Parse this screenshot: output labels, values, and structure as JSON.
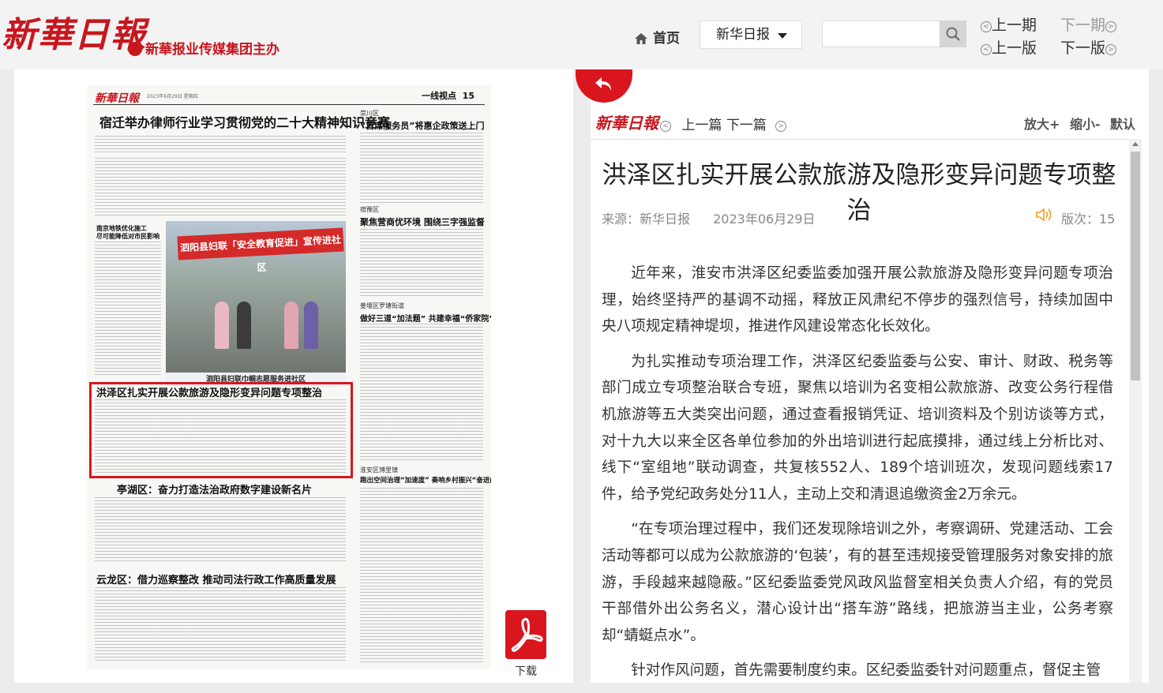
{
  "header": {
    "logo": "新華日報",
    "sponsor": "新華报业传媒集团主办",
    "home_label": "首页",
    "paper_select": "新华日报",
    "search_placeholder": "",
    "prev_issue": "上一期",
    "next_issue": "下一期",
    "prev_page": "上一版",
    "next_page": "下一版"
  },
  "newspaper": {
    "logo": "新華日報",
    "date": "2023年6月29日 星期四",
    "section": "一线视点",
    "page": "15",
    "headlines": {
      "h1": "宿迁举办律师行业学习贯彻党的二十大精神知识竞赛",
      "h2": "南京地铁优化施工",
      "h2b": "尽可能降低对市民影响",
      "h3": "“首席服务员”将惠企政策送上门",
      "h3_tag": "崇川区",
      "h4": "聚焦营商优环境 围绕三字强监督",
      "h4_tag": "宿豫区",
      "h5": "做好三道“加法题” 共建幸福“侨家院”",
      "h5_tag": "姜堰区罗塘街道",
      "h6": "洪泽区扎实开展公款旅游及隐形变异问题专项整治",
      "h7": "亭湖区：奋力打造法治政府数字建设新名片",
      "h8": "云龙区：借力巡察整改 推动司法行政工作高质量发展",
      "h9": "跑出空间治理“加速度” 奏响乡村振兴“奋进曲”",
      "h9_tag": "淮安区博里镇",
      "photo_banner": "泗阳县妇联「安全教育促进」宣传进社区",
      "photo_caption": "泗阳县妇联巾帼志愿服务进社区"
    }
  },
  "pdf": {
    "label": "下载"
  },
  "article_nav": {
    "logo": "新華日報",
    "prev": "上一篇",
    "next": "下一篇",
    "zoom_in": "放大+",
    "zoom_out": "缩小-",
    "default": "默认"
  },
  "article": {
    "title": "洪泽区扎实开展公款旅游及隐形变异问题专项整治",
    "source": "来源：新华日报",
    "date": "2023年06月29日",
    "page_label": "版次：15",
    "paragraphs": [
      "近年来，淮安市洪泽区纪委监委加强开展公款旅游及隐形变异问题专项治理，始终坚持严的基调不动摇，释放正风肃纪不停步的强烈信号，持续加固中央八项规定精神堤坝，推进作风建设常态化长效化。",
      "为扎实推动专项治理工作，洪泽区纪委监委与公安、审计、财政、税务等部门成立专项整治联合专班，聚焦以培训为名变相公款旅游、改变公务行程借机旅游等五大类突出问题，通过查看报销凭证、培训资料及个别访谈等方式，对十九大以来全区各单位参加的外出培训进行起底摸排，通过线上分析比对、线下“室组地”联动调查，共复核552人、189个培训班次，发现问题线索17件，给予党纪政务处分11人，主动上交和清退追缴资金2万余元。",
      "“在专项治理过程中，我们还发现除培训之外，考察调研、党建活动、工会活动等都可以成为公款旅游的‘包装’，有的甚至违规接受管理服务对象安排的旅游，手段越来越隐蔽。”区纪委监委党风政风监督室相关负责人介绍，有的党员干部借外出公务名义，潜心设计出“搭车游”路线，把旅游当主业，公务考察却“蜻蜓点水”。",
      "针对作风问题，首先需要制度约束。区纪委监委针对问题重点，督促主管"
    ]
  }
}
